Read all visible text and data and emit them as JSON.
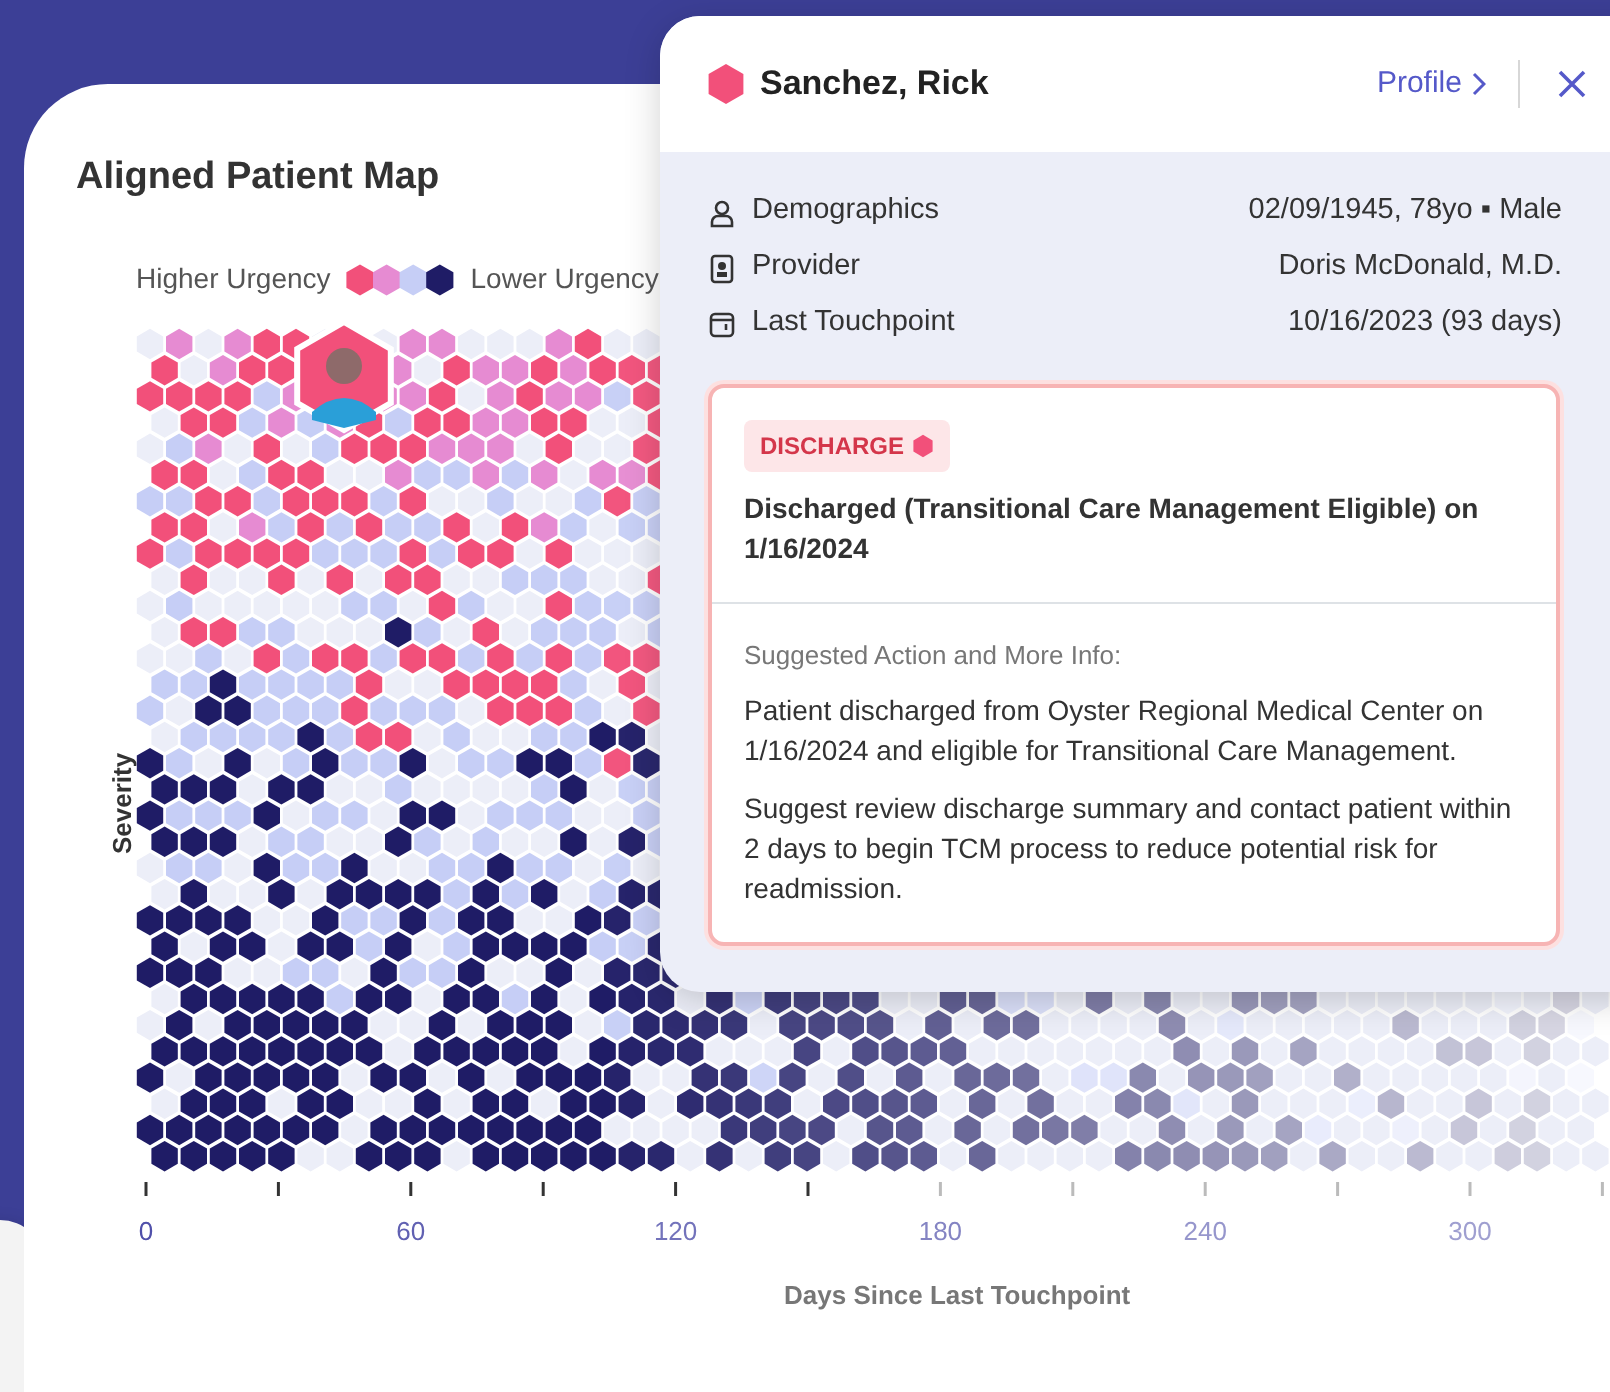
{
  "map": {
    "title": "Aligned Patient Map",
    "legend": {
      "high": "Higher Urgency",
      "low": "Lower Urgency"
    },
    "y_axis_label": "Severity",
    "x_axis_label": "Days Since Last Touchpoint",
    "x_ticks": [
      "0",
      "60",
      "120",
      "180",
      "240",
      "300"
    ]
  },
  "patient_panel": {
    "name": "Sanchez, Rick",
    "profile_link": "Profile",
    "details": [
      {
        "kind": "person",
        "label": "Demographics",
        "value": "02/09/1945, 78yo ▪ Male"
      },
      {
        "kind": "badge",
        "label": "Provider",
        "value": "Doris McDonald, M.D."
      },
      {
        "kind": "calendar",
        "label": "Last Touchpoint",
        "value": "10/16/2023 (93 days)"
      }
    ],
    "alert": {
      "tag": "DISCHARGE",
      "title": "Discharged (Transitional Care Management Eligible) on 1/16/2024",
      "subheading": "Suggested Action and More Info:",
      "paragraphs": [
        "Patient discharged from Oyster Regional Medical Center on 1/16/2024 and eligible for Transitional Care Management.",
        "Suggest review discharge summary and contact patient within 2 days to begin TCM process to reduce potential risk for readmission."
      ]
    }
  }
}
